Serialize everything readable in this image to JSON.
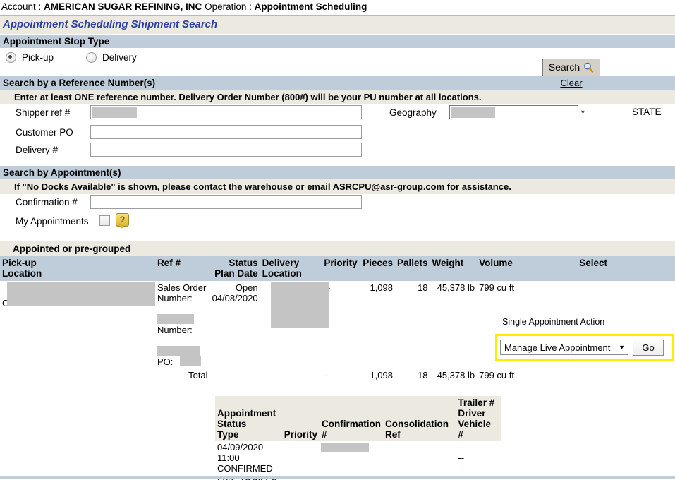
{
  "header": {
    "account_label": "Account :",
    "account_value": "AMERICAN SUGAR REFINING, INC",
    "operation_label": "Operation :",
    "operation_value": "Appointment Scheduling"
  },
  "page_title": "Appointment Scheduling Shipment Search",
  "stop_type": {
    "section_title": "Appointment Stop Type",
    "pickup_label": "Pick-up",
    "delivery_label": "Delivery",
    "pickup_selected": true
  },
  "search_controls": {
    "search_label": "Search",
    "search_icon": "magnifier-icon",
    "clear_label": "Clear"
  },
  "reference_section": {
    "title": "Search by a Reference Number(s)",
    "note": "Enter at least ONE reference number. Delivery Order Number (800#) will be your PU number at all locations.",
    "fields": [
      {
        "label": "Shipper ref #",
        "value": "",
        "redacted": true
      },
      {
        "label": "Customer PO",
        "value": "",
        "redacted": false
      },
      {
        "label": "Delivery #",
        "value": "",
        "redacted": false
      }
    ],
    "geography_label": "Geography",
    "geography_value": "",
    "geography_required_mark": "*",
    "geography_link": "STATE"
  },
  "appointment_section": {
    "title": "Search by Appointment(s)",
    "note": "If \"No Docks Available\" is shown, please contact the warehouse or email ASRCPU@asr-group.com for assistance.",
    "confirmation_label": "Confirmation #",
    "confirmation_value": "",
    "my_appointments_label": "My Appointments",
    "my_appointments_checked": false,
    "help_icon": "question-help-icon"
  },
  "results": {
    "title": "Appointed or pre-grouped",
    "columns": [
      "Pick-up Location",
      "Ref #",
      "Status Plan Date",
      "Delivery Location",
      "Priority",
      "Pieces",
      "Pallets",
      "Weight",
      "Volume",
      "Select"
    ],
    "row": {
      "pickup_location": "",
      "carrier_label": "Carrier: --",
      "ref_sales_order_label": "Sales Order Number:",
      "ref_sales_order_value": "",
      "ref_pickup_label": "Pickup Number:",
      "ref_pickup_value": "",
      "ref_customer_po_label": "Customer PO:",
      "ref_customer_po_value": "",
      "status": "Open",
      "plan_date": "04/08/2020",
      "delivery_location": "",
      "priority": "--",
      "pieces": "1,098",
      "pallets": "18",
      "weight": "45,378 lb",
      "volume": "799 cu ft"
    },
    "total": {
      "label": "Total",
      "priority": "--",
      "pieces": "1,098",
      "pallets": "18",
      "weight": "45,378 lb",
      "volume": "799 cu ft"
    }
  },
  "single_appointment_action": {
    "label": "Single Appointment Action",
    "selected_option": "Manage Live Appointment",
    "go_label": "Go",
    "highlight_color": "#ffec00"
  },
  "appointment_detail": {
    "columns": [
      "Appointment Status Type",
      "Priority",
      "Confirmation #",
      "Consolidation Ref",
      "Trailer # Driver Vehicle #"
    ],
    "rows": [
      {
        "appointment_lines": [
          "04/09/2020",
          "11:00",
          "CONFIRMED",
          "LIVE TRAILER"
        ],
        "priority": "--",
        "confirmation": "",
        "consolidation": "--",
        "trailer_lines": [
          "--",
          "--",
          "--"
        ]
      }
    ]
  },
  "colors": {
    "section_header": "#bfcddb",
    "note_band": "#ece9e1",
    "title_blue": "#2b3fa0",
    "redaction": "#c4c4c4"
  }
}
